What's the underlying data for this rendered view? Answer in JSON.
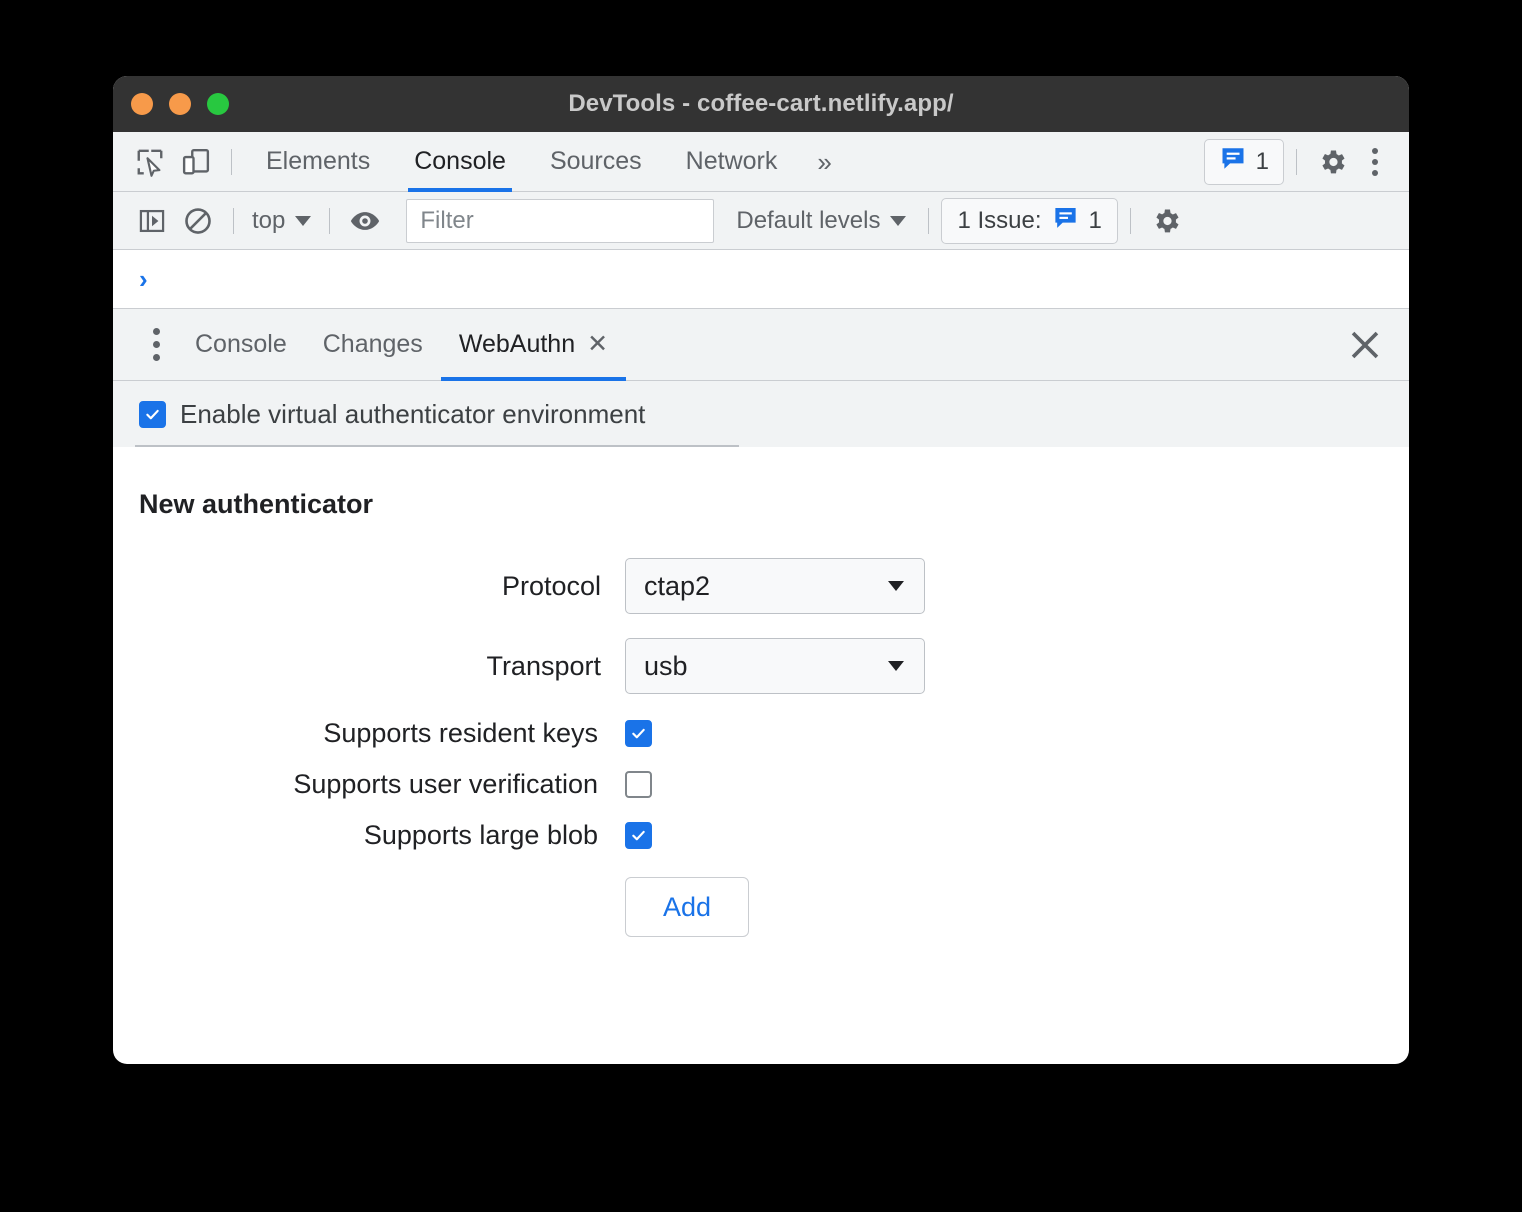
{
  "window": {
    "title": "DevTools - coffee-cart.netlify.app/",
    "controls": [
      "close",
      "minimize",
      "maximize"
    ]
  },
  "main_toolbar": {
    "inspect_icon": "inspect-element-icon",
    "device_icon": "device-toolbar-icon",
    "tabs": [
      {
        "label": "Elements",
        "active": false
      },
      {
        "label": "Console",
        "active": true
      },
      {
        "label": "Sources",
        "active": false
      },
      {
        "label": "Network",
        "active": false
      }
    ],
    "more_tabs_label": "»",
    "issues_count": "1",
    "issues_icon": "issue-message-icon",
    "settings_icon": "gear-icon",
    "more_icon": "more-vertical-icon"
  },
  "console_toolbar": {
    "sidebar_icon": "console-sidebar-icon",
    "clear_icon": "clear-console-icon",
    "context_label": "top",
    "eye_icon": "live-expression-eye-icon",
    "filter_placeholder": "Filter",
    "filter_value": "",
    "levels_label": "Default levels",
    "issue_chip_label": "1 Issue:",
    "issue_chip_count": "1",
    "settings_icon": "gear-icon"
  },
  "console_prompt": {
    "chevron": "›"
  },
  "drawer": {
    "menu_icon": "more-vertical-icon",
    "tabs": [
      {
        "label": "Console",
        "active": false,
        "closable": false
      },
      {
        "label": "Changes",
        "active": false,
        "closable": false
      },
      {
        "label": "WebAuthn",
        "active": true,
        "closable": true,
        "close_glyph": "✕"
      }
    ],
    "close_glyph": "✕"
  },
  "webauthn": {
    "enable_label": "Enable virtual authenticator environment",
    "enable_checked": true,
    "section_title": "New authenticator",
    "fields": [
      {
        "label": "Protocol",
        "value": "ctap2",
        "type": "select"
      },
      {
        "label": "Transport",
        "value": "usb",
        "type": "select"
      }
    ],
    "checkboxes": [
      {
        "label": "Supports resident keys",
        "checked": true
      },
      {
        "label": "Supports user verification",
        "checked": false
      },
      {
        "label": "Supports large blob",
        "checked": true
      }
    ],
    "add_label": "Add"
  },
  "colors": {
    "accent": "#1a73e8",
    "titlebar": "#333333",
    "toolbar": "#f1f3f4",
    "panel": "#ffffff",
    "text": "#202124",
    "muted": "#5f6368",
    "close_light": "#f79a4a",
    "min_light": "#f79a4a",
    "max_light": "#28c840"
  }
}
